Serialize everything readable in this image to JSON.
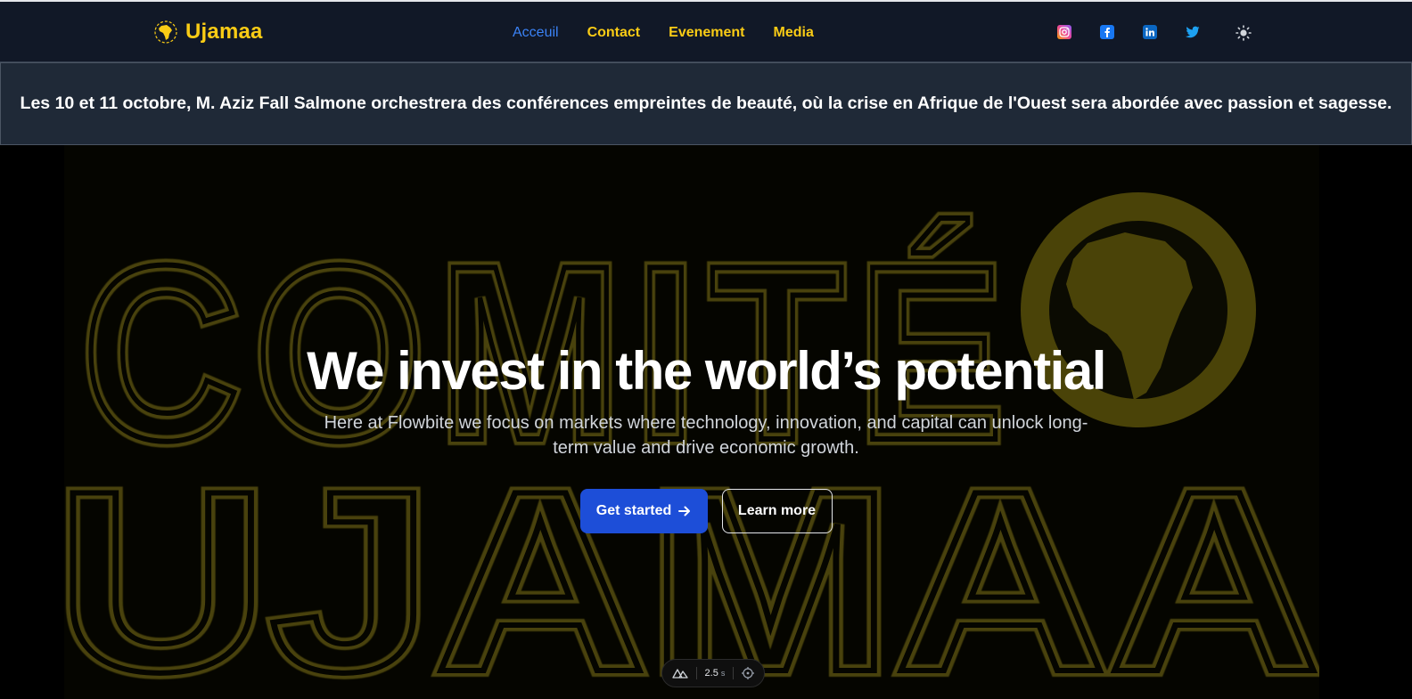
{
  "brand": {
    "name": "Ujamaa",
    "logo_icon": "africa-map-icon"
  },
  "nav": {
    "links": [
      {
        "label": "Acceuil",
        "active": true
      },
      {
        "label": "Contact",
        "active": false
      },
      {
        "label": "Evenement",
        "active": false
      },
      {
        "label": "Media",
        "active": false
      }
    ]
  },
  "socials": [
    "instagram-icon",
    "facebook-icon",
    "linkedin-icon",
    "twitter-icon"
  ],
  "theme_toggle_icon": "sun-icon",
  "announcement": {
    "text": "Les 10 et 11 octobre, M. Aziz Fall Salmone orchestrera des conférences empreintes de beauté, où la crise en Afrique de l'Ouest sera abordée avec passion et sagesse."
  },
  "hero": {
    "background_words": [
      "COMITÉ",
      "UJAMAA"
    ],
    "title": "We invest in the world’s potential",
    "subtitle": "Here at Flowbite we focus on markets where technology, innovation, and capital can unlock long-term value and drive economic growth.",
    "primary_button": "Get started",
    "secondary_button": "Learn more"
  },
  "devbar": {
    "time_value": "2.5",
    "time_unit": "s"
  },
  "colors": {
    "accent_yellow": "#facc15",
    "active_blue": "#3b82f6",
    "primary_button": "#1d4ed8",
    "navbar_bg": "#111827",
    "announce_bg": "#1f2937"
  }
}
